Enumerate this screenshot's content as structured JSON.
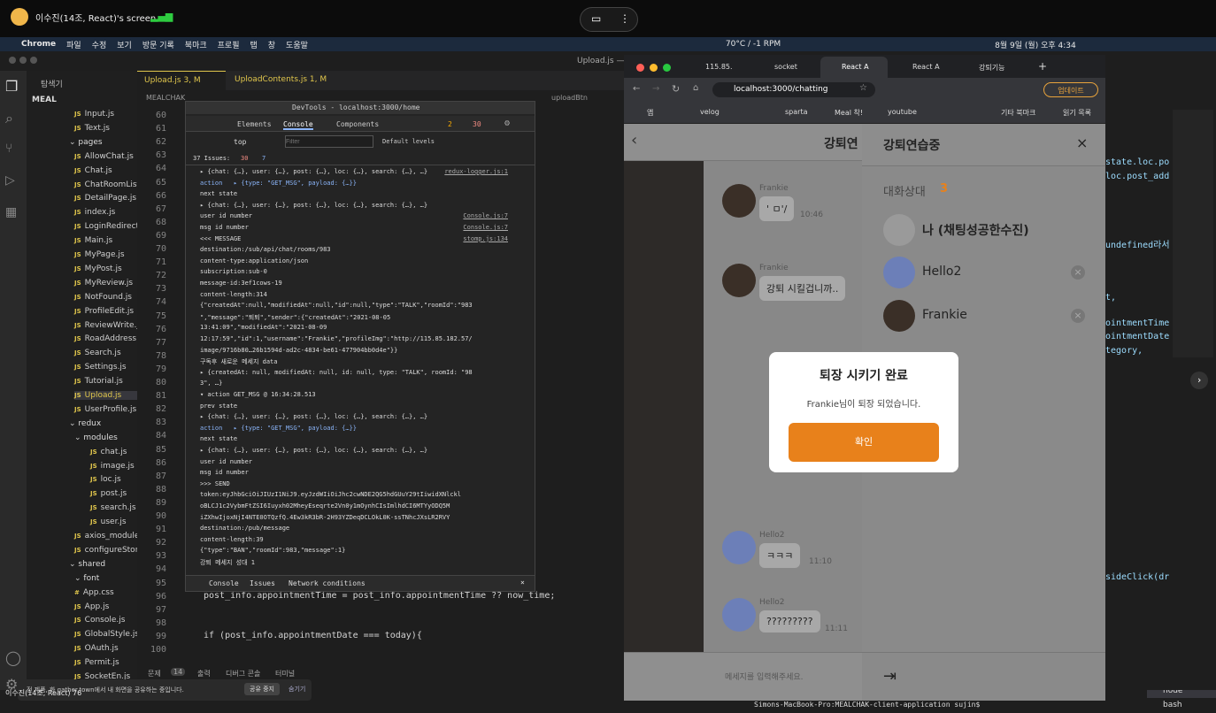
{
  "zoom": {
    "presenter": "이수진(14조, React)'s screen"
  },
  "mac": {
    "menus": [
      "Chrome",
      "파일",
      "수정",
      "보기",
      "방문 기록",
      "북마크",
      "프로필",
      "탭",
      "창",
      "도움말"
    ],
    "temp": "70°C / -1 RPM",
    "datetime": "8월 9일 (월) 오후 4:34"
  },
  "vscode": {
    "explorer_title": "탐색기",
    "root": "MEAL",
    "tabs": [
      "Upload.js 3, M",
      "UploadContents.js 1, M"
    ],
    "window_title": "Upload.js —",
    "breadcrumb_tail": "uploadBtn",
    "files": [
      "Input.js",
      "Text.js",
      "pages",
      "AllowChat.js",
      "Chat.js",
      "ChatRoomList.js",
      "DetailPage.js",
      "index.js",
      "LoginRedirect.js",
      "Main.js",
      "MyPage.js",
      "MyPost.js",
      "MyReview.js",
      "NotFound.js",
      "ProfileEdit.js",
      "ReviewWrite.js",
      "RoadAddress.js",
      "Search.js",
      "Settings.js",
      "Tutorial.js",
      "Upload.js",
      "UserProfile.js",
      "redux",
      "modules",
      "chat.js",
      "image.js",
      "loc.js",
      "post.js",
      "search.js",
      "user.js",
      "axios_module.js",
      "configureStore.js",
      "shared",
      "font",
      "App.css",
      "App.js",
      "Console.js",
      "GlobalStyle.js",
      "OAuth.js",
      "Permit.js",
      "SocketEn.js"
    ],
    "line_numbers": [
      "60",
      "61",
      "62",
      "63",
      "64",
      "65",
      "66",
      "67",
      "68",
      "69",
      "70",
      "71",
      "72",
      "73",
      "74",
      "75",
      "76",
      "77",
      "78",
      "79",
      "80",
      "81",
      "82",
      "83",
      "84",
      "85",
      "86",
      "87",
      "88",
      "89",
      "90",
      "91",
      "92",
      "93",
      "94",
      "95",
      "96",
      "97",
      "98",
      "99",
      "100"
    ],
    "code": [
      "post_info.appointmentTime = post_info.appointmentTime ?? now_time;",
      "if (post_info.appointmentDate === today){"
    ],
    "bottom_tabs": [
      "문제",
      "14",
      "출력",
      "디버그 콘솔",
      "터미널"
    ],
    "terminal_prompt": "Simons-MacBook-Pro:MEALCHAK-client-application sujin$",
    "terminal_items": [
      "node",
      "bash"
    ],
    "share_notice": "전 제품, 화 gather.town에서 내 화면을 공유하는 중입니다.",
    "share_stop": "공유 중지",
    "share_hide": "숨기기",
    "share_user": "이수진(14조, React) 76"
  },
  "devtools": {
    "title": "DevTools - localhost:3000/home",
    "tabs": [
      "Elements",
      "Console",
      "Components"
    ],
    "warn": "2",
    "err": "30",
    "top": "top",
    "filter": "Filter",
    "levels": "Default levels",
    "issues": "37 Issues:",
    "issues_err": "30",
    "issues_warn": "7",
    "lines": [
      "▸ {chat: {…}, user: {…}, post: {…}, loc: {…}, search: {…}, …}",
      "action   ▸ {type: \"GET_MSG\", payload: {…}}",
      "next state",
      "▸ {chat: {…}, user: {…}, post: {…}, loc: {…}, search: {…}, …}",
      "user id number",
      "msg id number",
      "<<< MESSAGE",
      "destination:/sub/api/chat/rooms/983",
      "content-type:application/json",
      "subscription:sub-0",
      "message-id:3ef1cows-19",
      "content-length:314",
      "{\"createdAt\":null,\"modifiedAt\":null,\"id\":null,\"type\":\"TALK\",\"roomId\":\"983",
      "\",\"message\":\"퇴퇴\",\"sender\":{\"createdAt\":\"2021-08-05",
      "13:41:09\",\"modifiedAt\":\"2021-08-09",
      "12:17:59\",\"id\":1,\"username\":\"Frankie\",\"profileImg\":\"http://115.85.182.57/",
      "image/9716b80…26b1594d-ad2c-4834-be61-477904bb0d4e\"}}",
      "구독후 새로운 메세지 data",
      "▸ {createdAt: null, modifiedAt: null, id: null, type: \"TALK\", roomId: \"98",
      "3\", …}",
      "▾ action GET_MSG @ 16:34:28.513",
      "prev state",
      "▸ {chat: {…}, user: {…}, post: {…}, loc: {…}, search: {…}, …}",
      "action   ▸ {type: \"GET_MSG\", payload: {…}}",
      "next state",
      "▸ {chat: {…}, user: {…}, post: {…}, loc: {…}, search: {…}, …}",
      "user id number",
      "msg id number",
      ">>> SEND",
      "token:eyJhbGciOiJIUzI1NiJ9.eyJzdWIiOiJhc2cwNDE2QG5hdGUuY29tIiwidXNlckl",
      "oBLCJ1c2VybmFtZSI6Iuyxh02MheyEseqrte2Vn0y1mOynhCIsImlhdCI6MTYyODQ5M",
      "iZXhwIjoxNjI4NTE0OTQzfQ.4Ew3kR3bR-2H93YZDeqDCLOkL0K-ssTNhcJXsLR2RVY",
      "destination:/pub/message",
      "content-length:39",
      "{\"type\":\"BAN\",\"roomId\":983,\"message\":1}",
      "강퇴 메세지 성대 1"
    ],
    "sources": [
      "redux-logger.js:1",
      "Console.js:7",
      "stomp.js:134"
    ],
    "drawer": [
      "Console",
      "Issues",
      "Network conditions"
    ]
  },
  "chrome": {
    "tabs": [
      "115.85.",
      "socket",
      "React A",
      "React A",
      "강퇴기능"
    ],
    "url": "localhost:3000/chatting",
    "update": "업데이트",
    "bookmarks": [
      "앱",
      "velog",
      "sparta",
      "Meal 착!",
      "youtube",
      "기타 북마크",
      "읽기 목록"
    ]
  },
  "chat": {
    "header": "강퇴연",
    "messages": [
      {
        "user": "Frankie",
        "text": "' ㅁ'/",
        "time": "10:46"
      },
      {
        "user": "Frankie",
        "text": "강퇴 시킬겁니까..",
        "time": ""
      },
      {
        "user": "Hello2",
        "text": "ㅋㅋㅋ",
        "time": "11:10"
      },
      {
        "user": "Hello2",
        "text": "?????????",
        "time": "11:11"
      }
    ],
    "input_placeholder": "메세지를 입력해주세요."
  },
  "panel": {
    "title": "강퇴연습중",
    "members_label": "대화상대",
    "members_count": "3",
    "members": [
      "나 (채팅성공한수진)",
      "Hello2",
      "Frankie"
    ]
  },
  "modal": {
    "title": "퇴장 시키기 완료",
    "message": "Frankie님이 퇴장 되었습니다.",
    "confirm": "확인"
  },
  "right_code": [
    "state.loc.po",
    "loc.post_add",
    "undefined라서",
    "t,",
    "ointmentTime",
    "ointmentDate",
    "tegory,",
    "sideClick(dr"
  ],
  "colors": {
    "accent": "#e8811b",
    "members_count": "#e8811b"
  }
}
